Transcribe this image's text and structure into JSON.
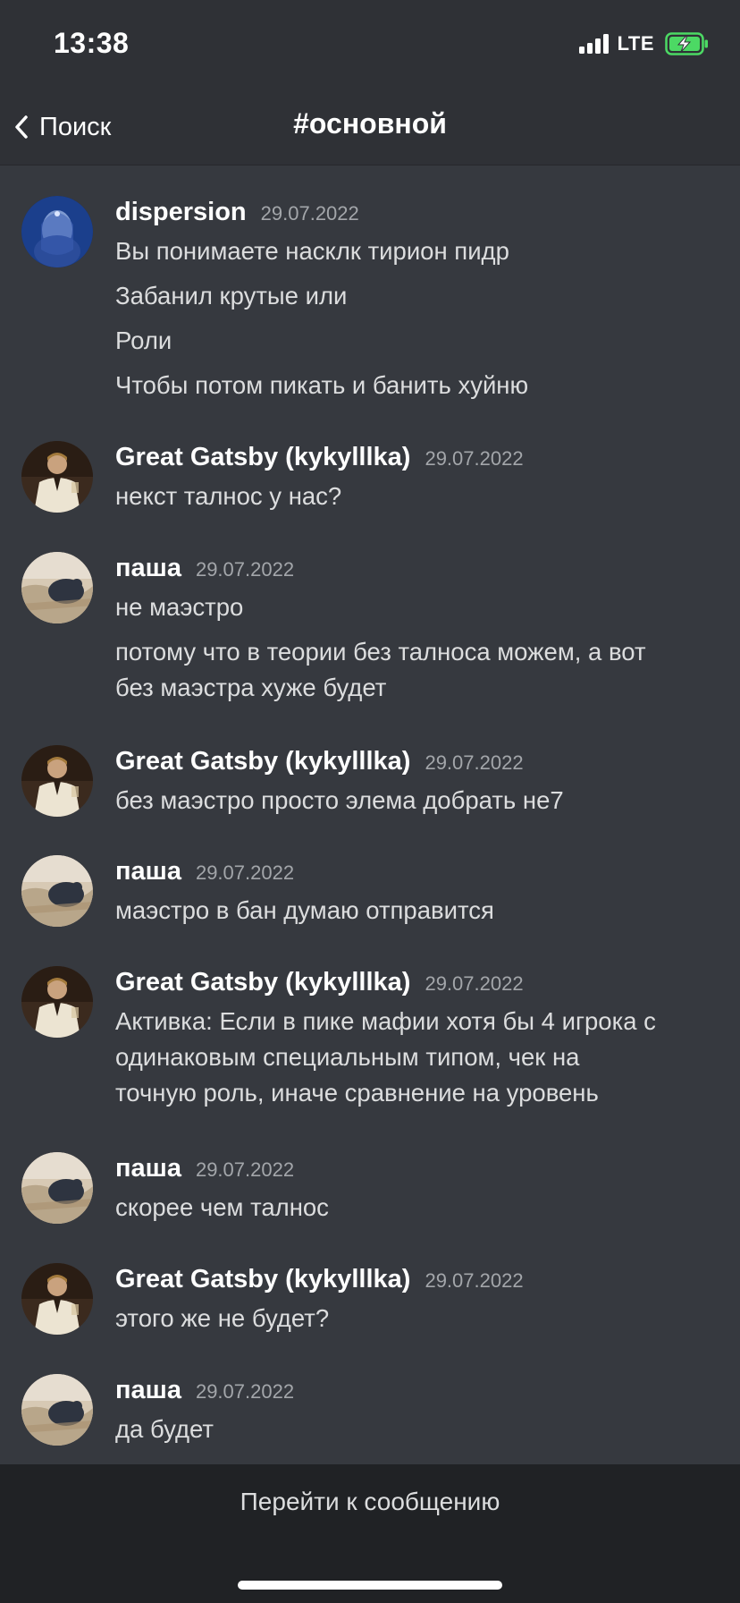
{
  "status_bar": {
    "time": "13:38",
    "network": "LTE",
    "icons": [
      "signal-icon",
      "battery-charging-icon"
    ]
  },
  "header": {
    "back_label": "Поиск",
    "back_icon": "chevron-left-icon",
    "channel": "#основной"
  },
  "colors": {
    "background": "#36393f",
    "header": "#2f3136",
    "bottom_bar": "#202225",
    "text": "#dcddde",
    "timestamp": "#a3a6aa",
    "battery_fill": "#4cd964"
  },
  "messages": [
    {
      "author": "dispersion",
      "date": "29.07.2022",
      "avatar": "avatar-icon",
      "lines": [
        "Вы понимаете насклк тирион пидр",
        "Забанил крутые или",
        "Роли",
        "Чтобы потом пикать и банить хуйню"
      ]
    },
    {
      "author": "Great Gatsby (kykylllka)",
      "date": "29.07.2022",
      "avatar": "avatar-icon",
      "lines": [
        "некст талнос у нас?"
      ]
    },
    {
      "author": "паша",
      "date": "29.07.2022",
      "avatar": "avatar-icon",
      "lines": [
        "не маэстро",
        "потому что в теории без талноса можем, а вот",
        "без маэстра хуже будет"
      ]
    },
    {
      "author": "Great Gatsby (kykylllka)",
      "date": "29.07.2022",
      "avatar": "avatar-icon",
      "lines": [
        "без маэстро просто элема добрать не7"
      ]
    },
    {
      "author": "паша",
      "date": "29.07.2022",
      "avatar": "avatar-icon",
      "lines": [
        "маэстро в бан думаю отправится"
      ]
    },
    {
      "author": "Great Gatsby (kykylllka)",
      "date": "29.07.2022",
      "avatar": "avatar-icon",
      "lines": [
        "Активка: Если в пике мафии хотя бы 4 игрока с",
        "одинаковым специальным типом, чек на",
        "точную роль, иначе сравнение на уровень"
      ]
    },
    {
      "author": "паша",
      "date": "29.07.2022",
      "avatar": "avatar-icon",
      "lines": [
        "скорее чем талнос"
      ]
    },
    {
      "author": "Great Gatsby (kykylllka)",
      "date": "29.07.2022",
      "avatar": "avatar-icon",
      "lines": [
        "этого же не будет?"
      ]
    },
    {
      "author": "паша",
      "date": "29.07.2022",
      "avatar": "avatar-icon",
      "lines": [
        "да будет"
      ]
    }
  ],
  "footer": {
    "jump_label": "Перейти к сообщению"
  }
}
